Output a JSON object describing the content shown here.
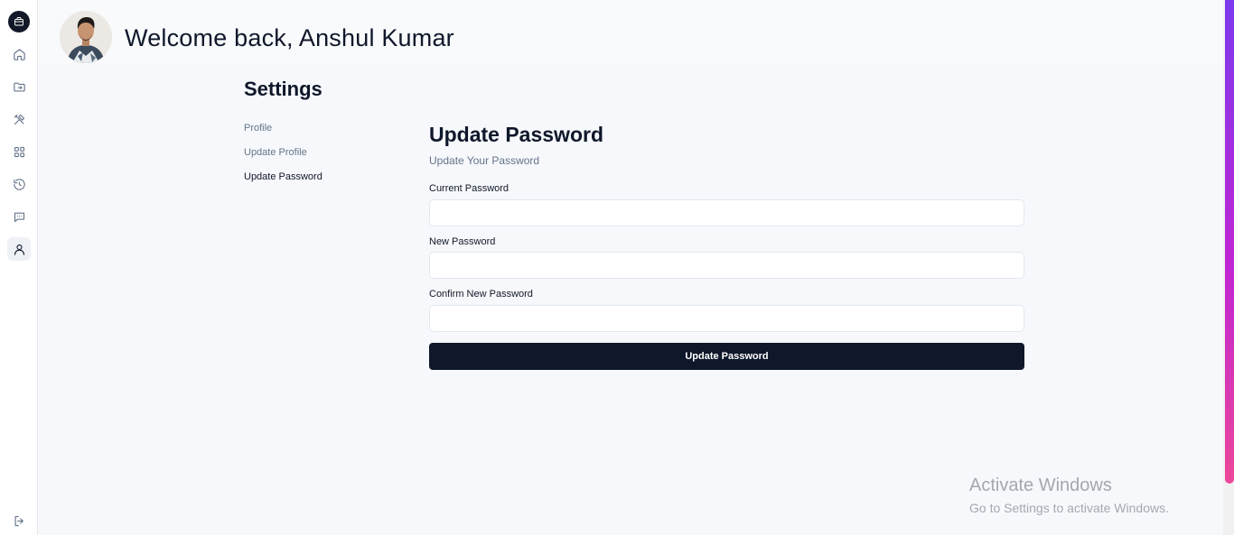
{
  "header": {
    "welcome": "Welcome back, Anshul Kumar"
  },
  "sidebar": {
    "icons": [
      "briefcase-icon",
      "home-icon",
      "folder-icon",
      "tools-icon",
      "grid-icon",
      "history-icon",
      "chat-icon",
      "user-icon",
      "logout-icon"
    ],
    "active": "user-icon"
  },
  "settings": {
    "title": "Settings",
    "nav": [
      {
        "label": "Profile"
      },
      {
        "label": "Update Profile"
      },
      {
        "label": "Update Password"
      }
    ]
  },
  "form": {
    "title": "Update Password",
    "subtitle": "Update Your Password",
    "fields": [
      {
        "label": "Current Password",
        "value": ""
      },
      {
        "label": "New Password",
        "value": ""
      },
      {
        "label": "Confirm New Password",
        "value": ""
      }
    ],
    "submit_label": "Update Password"
  },
  "watermark": {
    "line1": "Activate Windows",
    "line2": "Go to Settings to activate Windows."
  },
  "colors": {
    "primary": "#0f172a",
    "muted": "#64748b",
    "background": "#f6f8fb"
  }
}
